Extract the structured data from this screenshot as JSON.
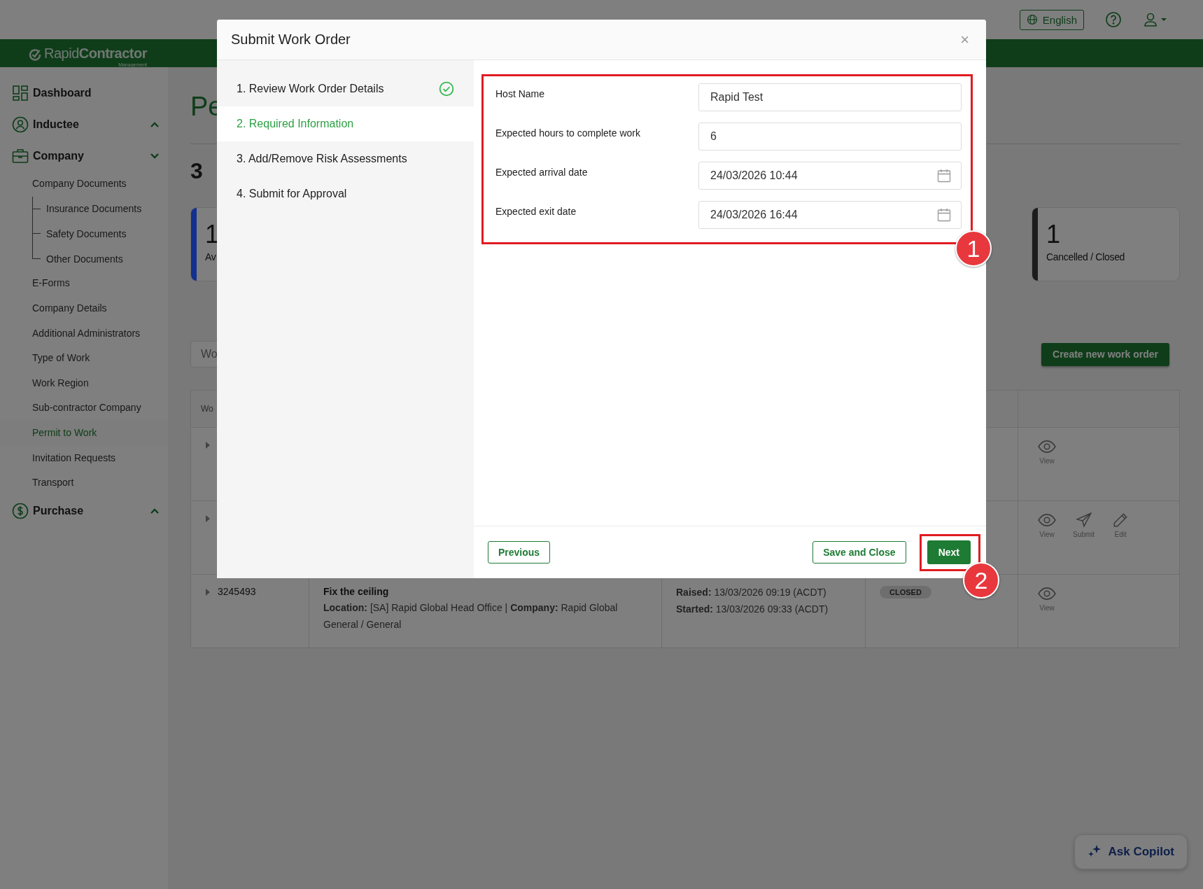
{
  "topbar": {
    "language": "English"
  },
  "brand": {
    "name_part1": "Rapid",
    "name_part2": "Contractor",
    "tagline": "Management"
  },
  "sidebar": {
    "items": [
      {
        "label": "Dashboard"
      },
      {
        "label": "Inductee",
        "expanded": false
      },
      {
        "label": "Company",
        "expanded": true,
        "children": [
          {
            "label": "Company Documents",
            "selected": false,
            "children": [
              {
                "label": "Insurance Documents",
                "selected": false
              },
              {
                "label": "Safety Documents",
                "selected": false
              },
              {
                "label": "Other Documents",
                "selected": false
              }
            ]
          },
          {
            "label": "E-Forms",
            "selected": false
          },
          {
            "label": "Company Details",
            "selected": false
          },
          {
            "label": "Additional Administrators",
            "selected": false
          },
          {
            "label": "Type of Work",
            "selected": false
          },
          {
            "label": "Work Region",
            "selected": false
          },
          {
            "label": "Sub-contractor Company",
            "selected": false
          },
          {
            "label": "Permit to Work",
            "selected": true
          },
          {
            "label": "Invitation Requests",
            "selected": false
          },
          {
            "label": "Transport",
            "selected": false
          }
        ]
      },
      {
        "label": "Purchase",
        "expanded": false
      }
    ]
  },
  "main": {
    "page_title": "Pe",
    "count_heading": "3",
    "summary_cards": [
      {
        "value": "1",
        "label": "Av",
        "color": "#12308f"
      },
      {
        "value": "1",
        "label": "Cancelled / Closed",
        "color": "#1c1c1c"
      }
    ],
    "search": {
      "placeholder": "Wo"
    },
    "create_button": "Create new work order",
    "table": {
      "columns": [
        {
          "label": "Wo"
        }
      ],
      "rows": [
        {
          "actions": [
            {
              "kind": "view",
              "label": "View"
            }
          ]
        },
        {
          "actions": [
            {
              "kind": "view",
              "label": "View"
            },
            {
              "kind": "submit",
              "label": "Submit"
            },
            {
              "kind": "edit",
              "label": "Edit"
            }
          ]
        },
        {
          "id": "3245493",
          "title": "Fix the ceiling",
          "details": "**Location:** [SA] Rapid Global Head Office | **Company:** Rapid Global General / General",
          "raised": "**Raised:** 13/03/2026 09:19 (ACDT)",
          "started": "**Started:** 13/03/2026 09:33 (ACDT)",
          "status": "CLOSED",
          "actions": [
            {
              "kind": "view",
              "label": "View"
            }
          ]
        }
      ]
    }
  },
  "modal": {
    "title": "Submit Work Order",
    "close": "×",
    "steps": [
      {
        "label": "1. Review Work Order Details",
        "selected": false,
        "completed": true
      },
      {
        "label": "2. Required Information",
        "selected": true,
        "completed": false
      },
      {
        "label": "3. Add/Remove Risk Assessments",
        "selected": false,
        "completed": false
      },
      {
        "label": "4. Submit for Approval",
        "selected": false,
        "completed": false
      }
    ],
    "fields": [
      {
        "label": "Host Name",
        "value": "Rapid Test",
        "kind": "text"
      },
      {
        "label": "Expected hours to complete work",
        "value": "6",
        "kind": "text"
      },
      {
        "label": "Expected arrival date",
        "value": "24/03/2026 10:44",
        "kind": "datetime"
      },
      {
        "label": "Expected exit date",
        "value": "24/03/2026 16:44",
        "kind": "datetime"
      }
    ],
    "buttons": {
      "previous": "Previous",
      "save": "Save and Close",
      "next": "Next"
    }
  },
  "annotations": [
    {
      "number": "1"
    },
    {
      "number": "2"
    }
  ],
  "copilot": {
    "label": "Ask Copilot"
  }
}
